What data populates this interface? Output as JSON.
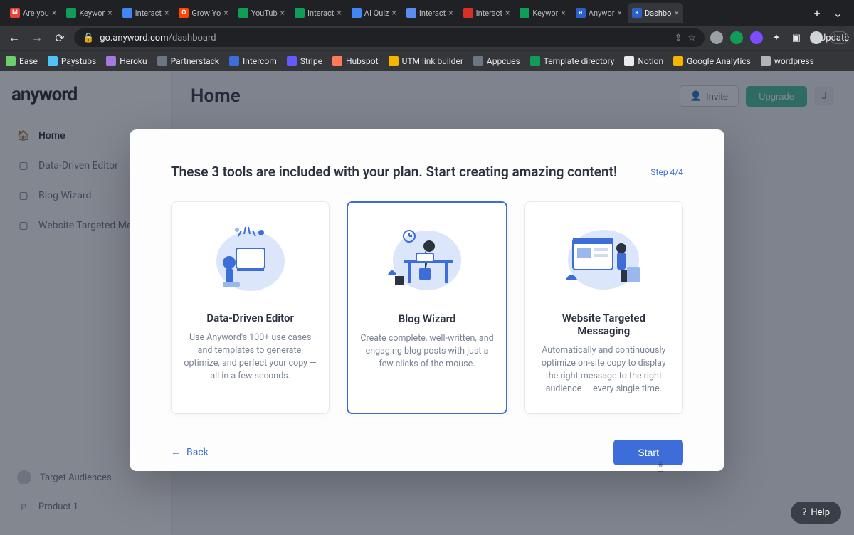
{
  "browser": {
    "tabs": [
      {
        "title": "Are you",
        "favicon_bg": "#ea4335",
        "favicon_text": "M"
      },
      {
        "title": "Keywor",
        "favicon_bg": "#0f9d58",
        "favicon_text": ""
      },
      {
        "title": "Interact",
        "favicon_bg": "#4285f4",
        "favicon_text": ""
      },
      {
        "title": "Grow Yo",
        "favicon_bg": "#ff4500",
        "favicon_text": "O"
      },
      {
        "title": "YouTub",
        "favicon_bg": "#0f9d58",
        "favicon_text": ""
      },
      {
        "title": "Interact",
        "favicon_bg": "#0f9d58",
        "favicon_text": ""
      },
      {
        "title": "AI Quiz",
        "favicon_bg": "#4285f4",
        "favicon_text": ""
      },
      {
        "title": "Interact",
        "favicon_bg": "#5b8def",
        "favicon_text": ""
      },
      {
        "title": "Interact",
        "favicon_bg": "#d93025",
        "favicon_text": ""
      },
      {
        "title": "Keywor",
        "favicon_bg": "#0f9d58",
        "favicon_text": ""
      },
      {
        "title": "Anywor",
        "favicon_bg": "#2d5fcc",
        "favicon_text": "a"
      },
      {
        "title": "Dashbo",
        "favicon_bg": "#2d5fcc",
        "favicon_text": "a",
        "active": true
      }
    ],
    "url_domain": "go.anyword.com",
    "url_path": "/dashboard",
    "update_label": "Update",
    "bookmarks": [
      {
        "label": "Ease",
        "color": "#6bcf6b"
      },
      {
        "label": "Paystubs",
        "color": "#4fc3f7"
      },
      {
        "label": "Heroku",
        "color": "#a479e0"
      },
      {
        "label": "Partnerstack",
        "color": "#6b7685"
      },
      {
        "label": "Intercom",
        "color": "#3d6dd8"
      },
      {
        "label": "Stripe",
        "color": "#635bff"
      },
      {
        "label": "Hubspot",
        "color": "#ff7a59"
      },
      {
        "label": "UTM link builder",
        "color": "#f4b400"
      },
      {
        "label": "Appcues",
        "color": "#6b7685"
      },
      {
        "label": "Template directory",
        "color": "#0f9d58"
      },
      {
        "label": "Notion",
        "color": "#e8eaed"
      },
      {
        "label": "Google Analytics",
        "color": "#f4b400"
      },
      {
        "label": "wordpress",
        "color": "#b0b4ba"
      }
    ]
  },
  "app": {
    "logo": "anyword",
    "nav": [
      {
        "label": "Home",
        "icon": "home",
        "active": true
      },
      {
        "label": "Data-Driven Editor",
        "icon": "doc"
      },
      {
        "label": "Blog Wizard",
        "icon": "doc"
      },
      {
        "label": "Website Targeted Mess",
        "icon": "doc"
      }
    ],
    "footer_nav": [
      {
        "label": "Target Audiences",
        "icon": "avatar"
      },
      {
        "label": "Product 1",
        "icon": "p"
      }
    ],
    "page_title": "Home",
    "invite_label": "Invite",
    "upgrade_label": "Upgrade",
    "user_initial": "J"
  },
  "modal": {
    "heading": "These 3 tools are included with your plan. Start creating amazing content!",
    "step": "Step 4/4",
    "cards": [
      {
        "title": "Data-Driven Editor",
        "desc": "Use Anyword's 100+ use cases and templates to generate, optimize, and perfect your copy — all in a few seconds.",
        "selected": false
      },
      {
        "title": "Blog Wizard",
        "desc": "Create complete, well-written, and engaging blog posts with just a few clicks of the mouse.",
        "selected": true
      },
      {
        "title": "Website Targeted Messaging",
        "desc": "Automatically and continuously optimize on-site copy to display the right message to the right audience — every single time.",
        "selected": false
      }
    ],
    "back_label": "Back",
    "start_label": "Start"
  },
  "help_label": "Help"
}
